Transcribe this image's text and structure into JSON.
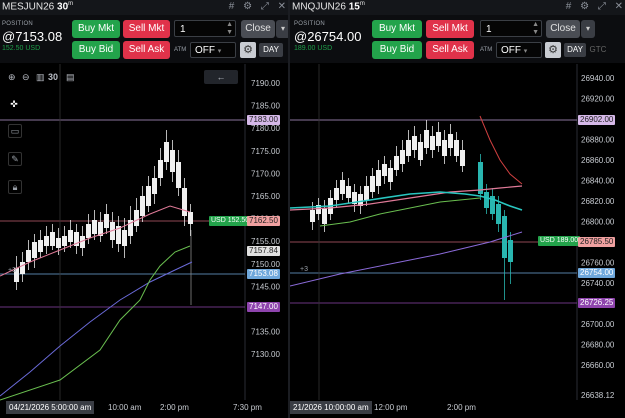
{
  "left": {
    "instrument": "MESJUN26",
    "timeframe": "30",
    "timeframe_unit": "m",
    "position_label": "POSITION",
    "position_price": "@7153.08",
    "position_sub": "152.50 USD",
    "buy_mkt": "Buy Mkt",
    "sell_mkt": "Sell Mkt",
    "buy_bid": "Buy Bid",
    "sell_ask": "Sell Ask",
    "qty": "1",
    "close": "Close",
    "atm_label": "ATM",
    "atm_value": "OFF",
    "day": "DAY",
    "interval_button": "30",
    "y_ticks": [
      "7190.00",
      "7185.00",
      "7180.00",
      "7175.00",
      "7170.00",
      "7165.00",
      "7160.00",
      "7155.00",
      "7150.00",
      "7145.00",
      "7140.00",
      "7135.00",
      "7130.00"
    ],
    "tags": {
      "top": "7183.00",
      "mid_red": "7162.50",
      "wavy": "7157.84",
      "current": "7153.08",
      "stop": "7147.00",
      "usd": "USD 152.50"
    },
    "time_cursor": "04/21/2026 5:00:00 am",
    "time_labels": [
      "10:00 am",
      "2:00 pm",
      "7:30 pm"
    ],
    "plus": "+3"
  },
  "right": {
    "instrument": "MNQJUN26",
    "timeframe": "15",
    "timeframe_unit": "m",
    "position_label": "POSITION",
    "position_price": "@26754.00",
    "position_sub": "189.00 USD",
    "buy_mkt": "Buy Mkt",
    "sell_mkt": "Sell Mkt",
    "buy_bid": "Buy Bid",
    "sell_ask": "Sell Ask",
    "qty": "1",
    "close": "Close",
    "atm_label": "ATM",
    "atm_value": "OFF",
    "day": "DAY",
    "gtc": "GTC",
    "y_ticks": [
      "26940.00",
      "26920.00",
      "26900.00",
      "26880.00",
      "26860.00",
      "26840.00",
      "26820.00",
      "26800.00",
      "26780.00",
      "26760.00",
      "26740.00",
      "26720.00",
      "26700.00",
      "26680.00",
      "26660.00",
      "26638.12"
    ],
    "tags": {
      "top": "26902.00",
      "mid_red": "26785.50",
      "current": "26754.00",
      "stop": "26726.25",
      "usd": "USD 189.00"
    },
    "time_cursor": "21/2026 10:00:00 am",
    "time_labels": [
      "12:00 pm",
      "2:00 pm"
    ],
    "plus": "+3"
  },
  "colors": {
    "buy": "#23a34b",
    "sell": "#e0324a",
    "current_tag": "#6fa8dc",
    "stop_tag": "#8e44ad",
    "top_tag": "#d5b8e8",
    "red_tag": "#f0a0a0",
    "usd_tag": "#23a34b"
  },
  "icons": [
    "zoom-in-icon",
    "zoom-out-icon",
    "bar-chart-icon",
    "back-arrow-icon",
    "crosshair-icon",
    "gear-icon",
    "maximize-icon",
    "close-icon",
    "cursor-icon",
    "pencil-icon",
    "lock-icon"
  ]
}
